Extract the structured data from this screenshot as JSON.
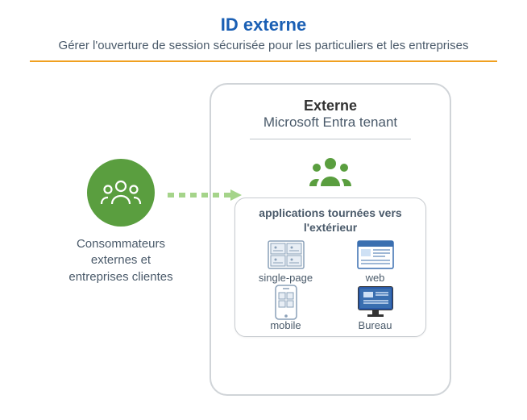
{
  "header": {
    "title": "ID externe",
    "subtitle": "Gérer l'ouverture de session sécurisée pour les particuliers et les entreprises"
  },
  "left": {
    "label": "Consommateurs externes et entreprises clientes"
  },
  "tenant": {
    "title": "Externe",
    "subtitle": "Microsoft Entra tenant",
    "apps_header": "applications tournées vers l'extérieur",
    "apps": {
      "spa": "single-page",
      "web": "web",
      "mobile": "mobile",
      "desktop": "Bureau"
    }
  },
  "chart_data": {
    "type": "diagram",
    "title": "ID externe",
    "subtitle": "Gérer l'ouverture de session sécurisée pour les particuliers et les entreprises",
    "nodes": [
      {
        "id": "consumers",
        "label": "Consommateurs externes et entreprises clientes"
      },
      {
        "id": "tenant",
        "label": "Externe – Microsoft Entra tenant",
        "children": [
          {
            "id": "users",
            "label": "external users"
          },
          {
            "id": "apps",
            "label": "applications tournées vers l'extérieur",
            "children": [
              {
                "id": "spa",
                "label": "single-page"
              },
              {
                "id": "web",
                "label": "web"
              },
              {
                "id": "mobile",
                "label": "mobile"
              },
              {
                "id": "desktop",
                "label": "Bureau"
              }
            ]
          }
        ]
      }
    ],
    "edges": [
      {
        "from": "consumers",
        "to": "tenant",
        "style": "dashed-arrow"
      }
    ]
  }
}
